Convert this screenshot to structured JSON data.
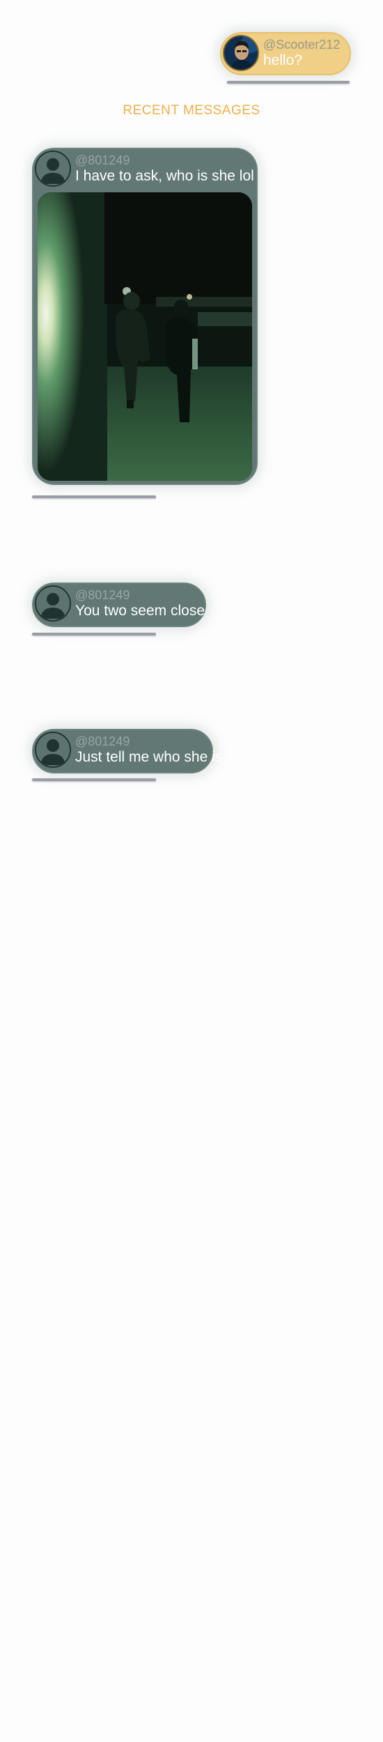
{
  "outgoing": {
    "handle": "@Scooter212",
    "text": "hello?"
  },
  "section_title": "RECENT MESSAGES",
  "messages": [
    {
      "handle": "@801249",
      "text": "I have to ask, who is she lol",
      "has_photo": true
    },
    {
      "handle": "@801249",
      "text": "You two seem close"
    },
    {
      "handle": "@801249",
      "text": "Just tell me who she is"
    }
  ],
  "colors": {
    "outgoing_bubble": "#f0cf86",
    "incoming_bubble": "#617874",
    "section_title": "#ecb04a",
    "divider": "#9a9ca6"
  }
}
